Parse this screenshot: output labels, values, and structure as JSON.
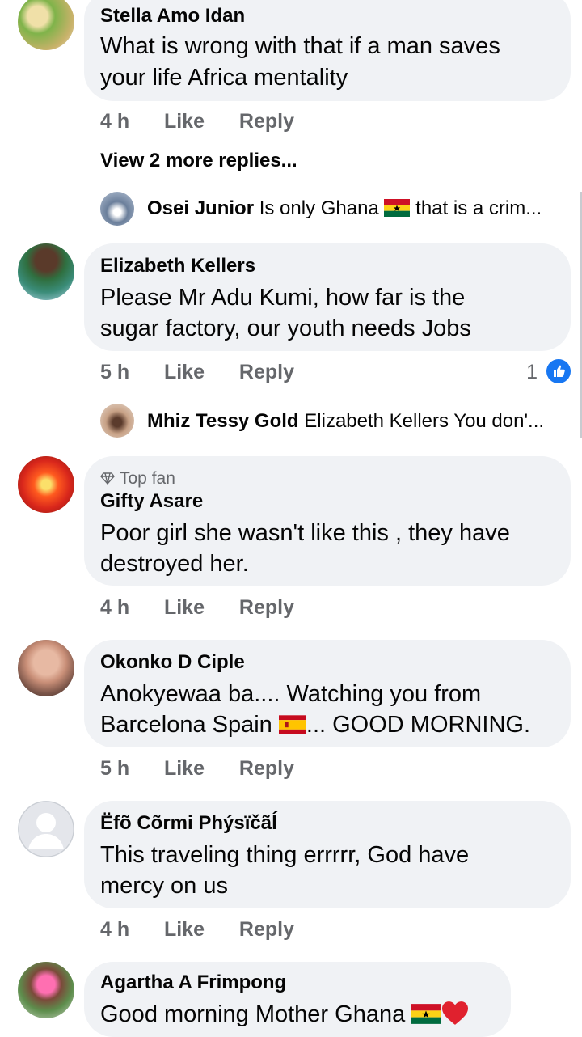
{
  "comments": [
    {
      "author": "Stella Amo Idan",
      "lines": [
        "What is wrong with that if a man saves",
        "your life Africa mentality"
      ],
      "time": "4 h",
      "like_label": "Like",
      "reply_label": "Reply",
      "view_more": "View 2 more replies...",
      "reply_preview": {
        "author": "Osei Junior",
        "text_a": "Is only Ghana",
        "text_b": "that is a crim..."
      }
    },
    {
      "author": "Elizabeth Kellers",
      "lines": [
        "Please  Mr Adu Kumi, how far is the",
        "sugar factory, our youth needs Jobs"
      ],
      "time": "5 h",
      "like_label": "Like",
      "reply_label": "Reply",
      "reaction_count": "1",
      "reply_preview": {
        "author": "Mhiz Tessy Gold",
        "text": "Elizabeth Kellers You don'..."
      }
    },
    {
      "badge": "Top fan",
      "author": "Gifty Asare",
      "lines": [
        "Poor girl she wasn't like this , they have",
        "destroyed her."
      ],
      "time": "4 h",
      "like_label": "Like",
      "reply_label": "Reply"
    },
    {
      "author": "Okonko D Ciple",
      "line1": "Anokyewaa ba.... Watching you from",
      "line2_a": "Barcelona Spain",
      "line2_b": "... GOOD MORNING.",
      "time": "5 h",
      "like_label": "Like",
      "reply_label": "Reply"
    },
    {
      "author": "Ëfõ Cõrmi Phýsïčãĺ",
      "lines": [
        "This traveling thing errrrr,  God have",
        "mercy on us"
      ],
      "time": "4 h",
      "like_label": "Like",
      "reply_label": "Reply"
    },
    {
      "author": "Agartha A Frimpong",
      "text": "Good morning Mother Ghana"
    }
  ],
  "colors": {
    "bubble": "#f0f2f5",
    "meta_text": "#65676b",
    "like_blue": "#1877f2",
    "heart_red": "#e0212e"
  }
}
